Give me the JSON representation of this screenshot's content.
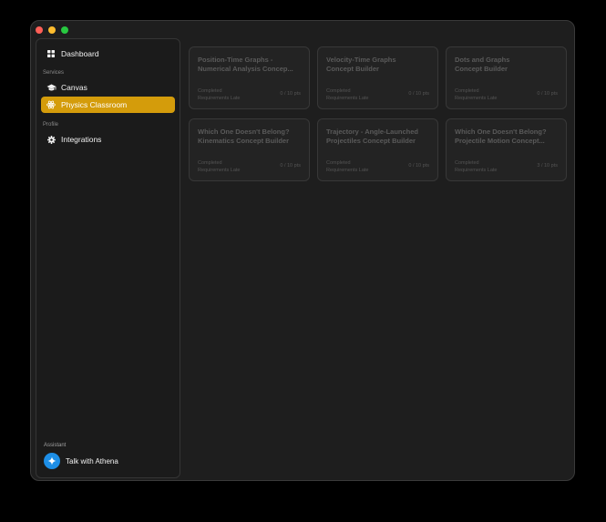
{
  "sidebar": {
    "dashboard_label": "Dashboard",
    "services_label": "Services",
    "canvas_label": "Canvas",
    "physics_label": "Physics Classroom",
    "profile_label": "Profile",
    "integrations_label": "Integrations",
    "assistant_label": "Assistant",
    "athena_label": "Talk with Athena"
  },
  "colors": {
    "accent": "#d49c0b",
    "assistant_blue": "#1d8ee6"
  },
  "cards": [
    {
      "title_line1": "Position-Time Graphs -",
      "title_line2": "Numerical Analysis Concep...",
      "status_line1": "Completed",
      "status_line2": "Requirements Late",
      "points": "0 / 10 pts"
    },
    {
      "title_line1": "Velocity-Time Graphs",
      "title_line2": "Concept Builder",
      "status_line1": "Completed",
      "status_line2": "Requirements Late",
      "points": "0 / 10 pts"
    },
    {
      "title_line1": "Dots and Graphs",
      "title_line2": "Concept Builder",
      "status_line1": "Completed",
      "status_line2": "Requirements Late",
      "points": "0 / 10 pts"
    },
    {
      "title_line1": "Which One Doesn't Belong?",
      "title_line2": "Kinematics Concept Builder",
      "status_line1": "Completed",
      "status_line2": "Requirements Late",
      "points": "0 / 10 pts"
    },
    {
      "title_line1": "Trajectory - Angle-Launched",
      "title_line2": "Projectiles Concept Builder",
      "status_line1": "Completed",
      "status_line2": "Requirements Late",
      "points": "0 / 10 pts"
    },
    {
      "title_line1": "Which One Doesn't Belong?",
      "title_line2": "Projectile Motion Concept...",
      "status_line1": "Completed",
      "status_line2": "Requirements Late",
      "points": "3 / 10 pts"
    }
  ]
}
